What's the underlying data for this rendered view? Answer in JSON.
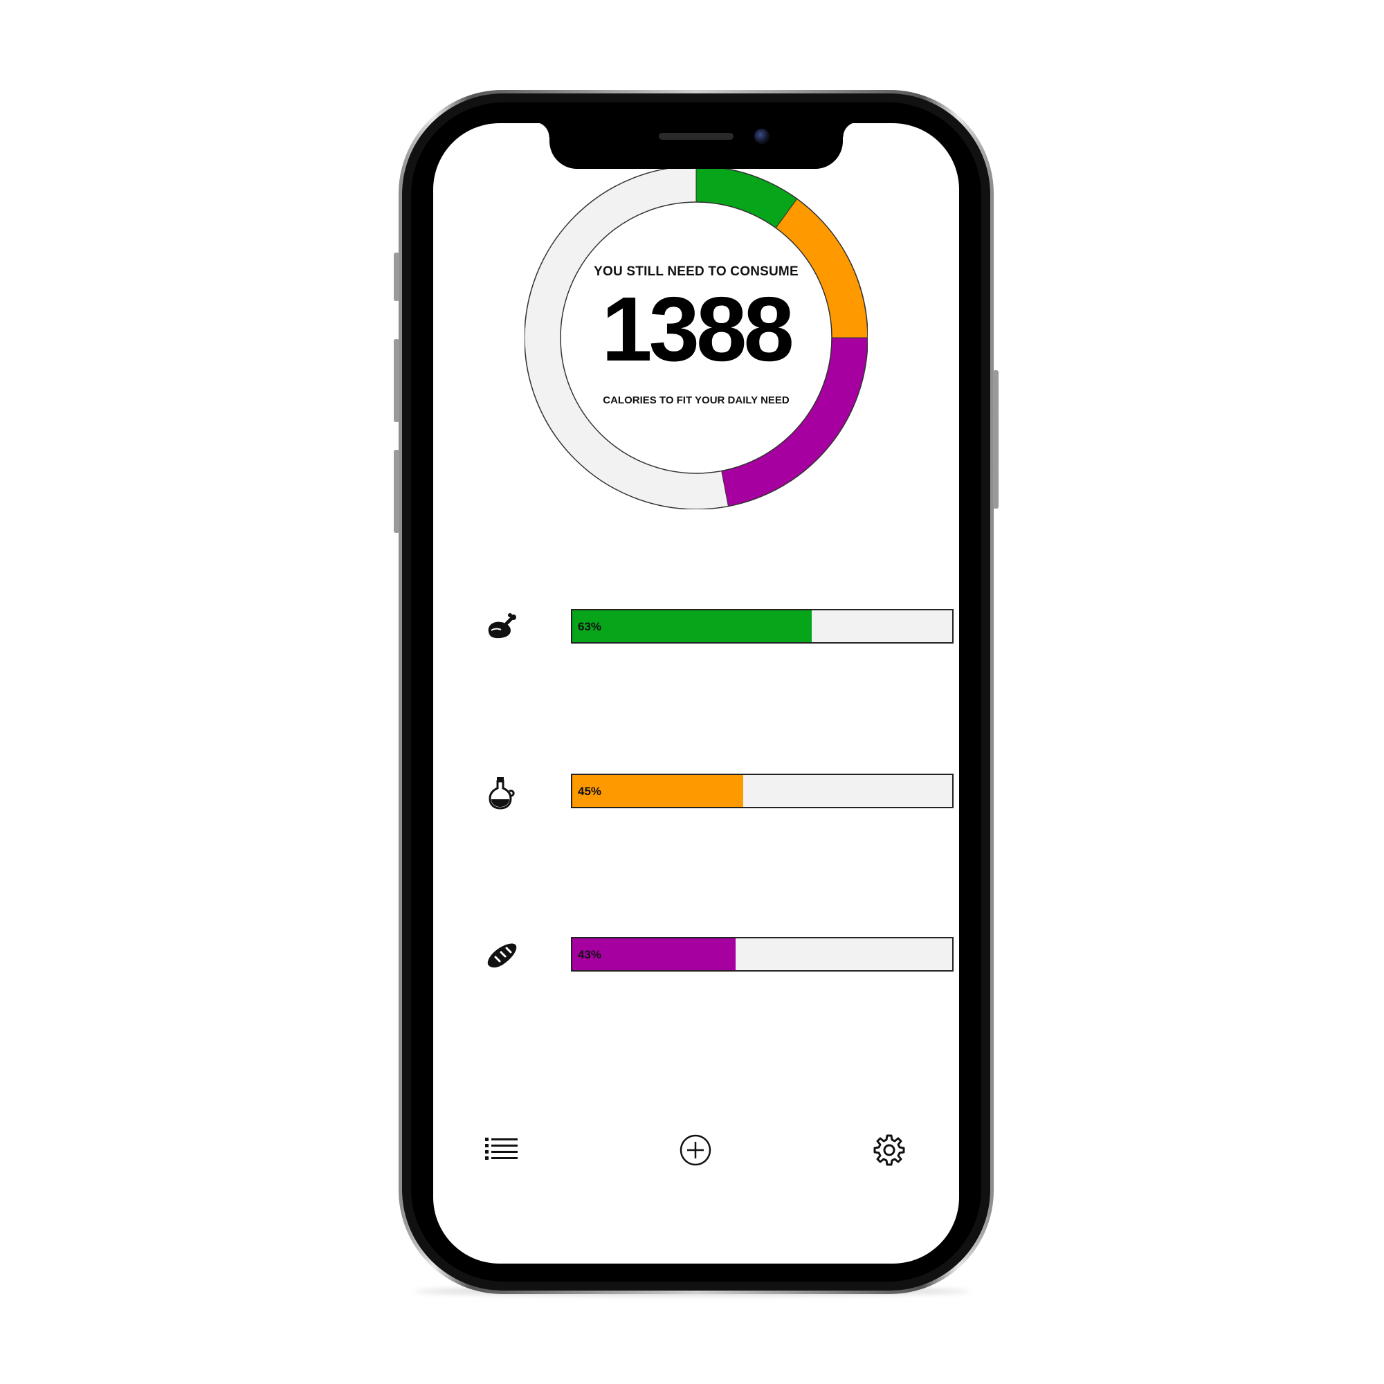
{
  "colors": {
    "protein": "#06a51a",
    "fat": "#ff9900",
    "carbs": "#a600a0",
    "track": "#f2f2f2",
    "outline": "#222222"
  },
  "summary": {
    "top_text": "YOU STILL NEED TO CONSUME",
    "calories_remaining": "1388",
    "bottom_text": "CALORIES TO FIT YOUR DAILY NEED"
  },
  "ring": {
    "segments": [
      {
        "name": "protein",
        "color": "#06a51a",
        "fraction": 0.1
      },
      {
        "name": "fat",
        "color": "#ff9900",
        "fraction": 0.15
      },
      {
        "name": "carbs",
        "color": "#a600a0",
        "fraction": 0.22
      }
    ]
  },
  "macros": [
    {
      "icon": "chicken-drumstick-icon",
      "percent": 63,
      "label": "63%",
      "color": "#06a51a"
    },
    {
      "icon": "oil-bottle-icon",
      "percent": 45,
      "label": "45%",
      "color": "#ff9900"
    },
    {
      "icon": "bread-icon",
      "percent": 43,
      "label": "43%",
      "color": "#a600a0"
    }
  ],
  "nav": [
    {
      "icon": "list-icon"
    },
    {
      "icon": "add-circle-icon"
    },
    {
      "icon": "settings-gear-icon"
    }
  ]
}
